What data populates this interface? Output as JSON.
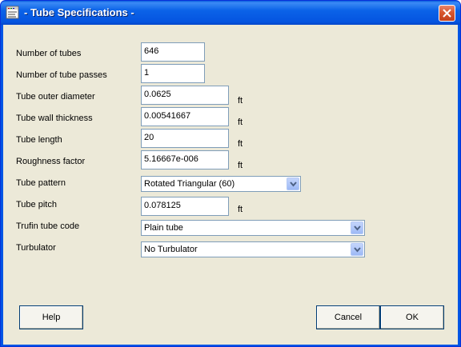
{
  "window": {
    "title": "- Tube Specifications -"
  },
  "fields": {
    "number_of_tubes": {
      "label": "Number of tubes",
      "value": "646"
    },
    "number_of_tube_passes": {
      "label": "Number of tube passes",
      "value": "1"
    },
    "tube_outer_diameter": {
      "label": "Tube outer diameter",
      "value": "0.0625",
      "unit": "ft"
    },
    "tube_wall_thickness": {
      "label": "Tube wall thickness",
      "value": "0.00541667",
      "unit": "ft"
    },
    "tube_length": {
      "label": "Tube length",
      "value": "20",
      "unit": "ft"
    },
    "roughness_factor": {
      "label": "Roughness factor",
      "value": "5.16667e-006",
      "unit": "ft"
    },
    "tube_pattern": {
      "label": "Tube pattern",
      "value": "Rotated Triangular (60)"
    },
    "tube_pitch": {
      "label": "Tube pitch",
      "value": "0.078125",
      "unit": "ft"
    },
    "trufin_tube_code": {
      "label": "Trufin tube code",
      "value": "Plain tube"
    },
    "turbulator": {
      "label": "Turbulator",
      "value": "No Turbulator"
    }
  },
  "buttons": {
    "help": "Help",
    "cancel": "Cancel",
    "ok": "OK"
  },
  "colors": {
    "titlebar": "#0058e6",
    "client": "#ece9d8",
    "field_border": "#7f9db9",
    "close": "#d8572e"
  },
  "icons": {
    "app": "document-app-icon",
    "close": "close-icon",
    "dropdown": "chevron-down-icon"
  }
}
